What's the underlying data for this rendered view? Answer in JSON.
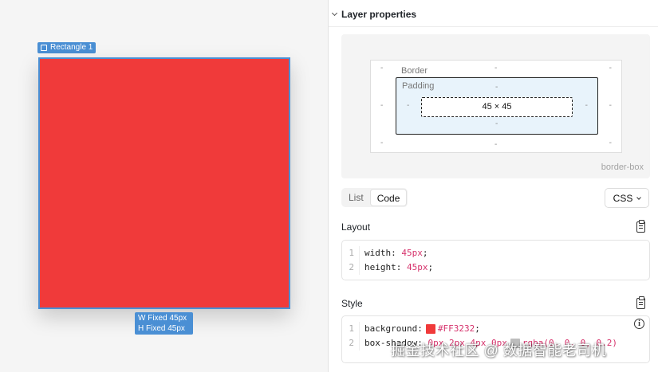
{
  "canvas": {
    "layer_name": "Rectangle 1",
    "width_label": "W Fixed 45px",
    "height_label": "H Fixed 45px",
    "fill_color": "#FF3232",
    "selection_color": "#4a8fd4"
  },
  "panel": {
    "title": "Layer properties",
    "box_model": {
      "border_label": "Border",
      "padding_label": "Padding",
      "content_size": "45 × 45",
      "placeholder": "-",
      "sizing": "border-box"
    },
    "view_tabs": [
      {
        "label": "List",
        "active": false
      },
      {
        "label": "Code",
        "active": true
      }
    ],
    "language": "CSS",
    "layout": {
      "title": "Layout",
      "lines": [
        {
          "num": "1",
          "prop": "width:",
          "value": "45px",
          "end": ";"
        },
        {
          "num": "2",
          "prop": "height:",
          "value": "45px",
          "end": ";"
        }
      ]
    },
    "style": {
      "title": "Style",
      "lines": [
        {
          "num": "1",
          "prop": "background:",
          "value": "#FF3232",
          "end": ";",
          "swatch": "#F03A3A"
        },
        {
          "num": "2",
          "prop": "box-shadow:",
          "value": "0px 2px 4px 0px",
          "swatch": "#BDBDBD",
          "value2": "rgba(0, 0, 0, 0.2)"
        }
      ]
    }
  },
  "watermark": "掘金技术社区 @ 数据智能老司机"
}
